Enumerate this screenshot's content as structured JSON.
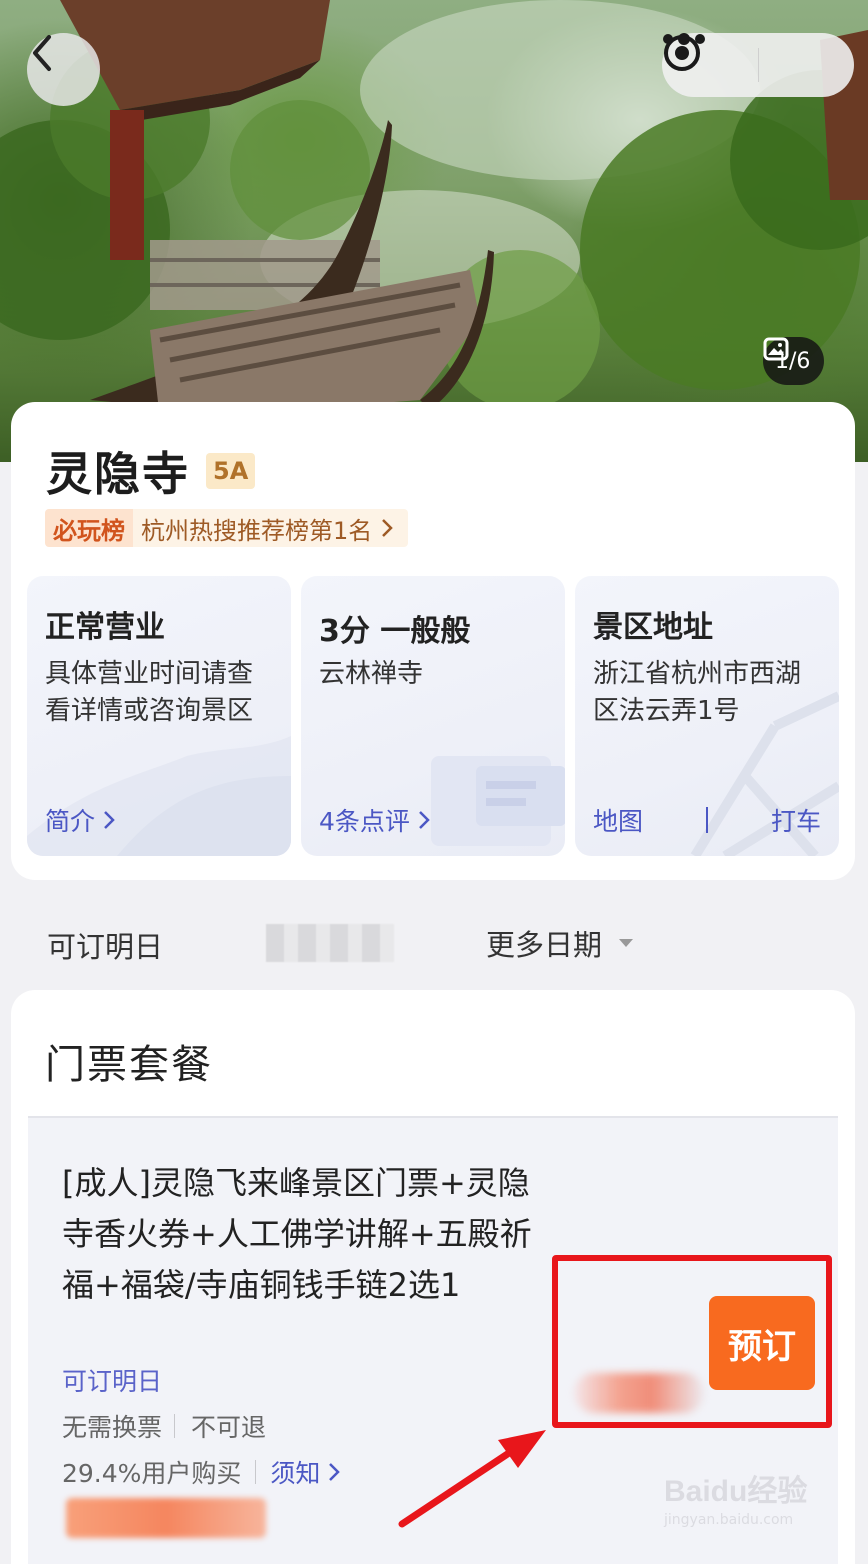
{
  "hero": {
    "photo_counter": "1/6"
  },
  "attraction": {
    "name": "灵隐寺",
    "grade": "5A",
    "rank_tag": "必玩榜",
    "rank_text": "杭州热搜推荐榜第1名"
  },
  "tiles": {
    "status": {
      "heading": "正常营业",
      "body": "具体营业时间请查看详情或咨询景区",
      "link": "简介"
    },
    "rating": {
      "heading": "3分 一般般",
      "body": "云林禅寺",
      "link": "4条点评"
    },
    "address": {
      "heading": "景区地址",
      "body": "浙江省杭州市西湖区法云弄1号",
      "map_link": "地图",
      "taxi_link": "打车"
    }
  },
  "date_bar": {
    "label": "可订明日",
    "more_label": "更多日期"
  },
  "tickets": {
    "section_title": "门票套餐",
    "items": [
      {
        "name": "[成人]灵隐飞来峰景区门票+灵隐寺香火券+人工佛学讲解+五殿祈福+福袋/寺庙铜钱手链2选1",
        "availability": "可订明日",
        "tag_1": "无需换票",
        "tag_2": "不可退",
        "purchase_rate": "29.4%用户购买",
        "notice": "须知",
        "book_label": "预订"
      }
    ]
  },
  "watermark": {
    "logo": "Baidu经验",
    "sub": "jingyan.baidu.com"
  },
  "colors": {
    "accent_blue": "#4b57c4",
    "book_orange": "#f86a1f",
    "annotation_red": "#e8161b",
    "grade_gold": "#b0722a"
  }
}
